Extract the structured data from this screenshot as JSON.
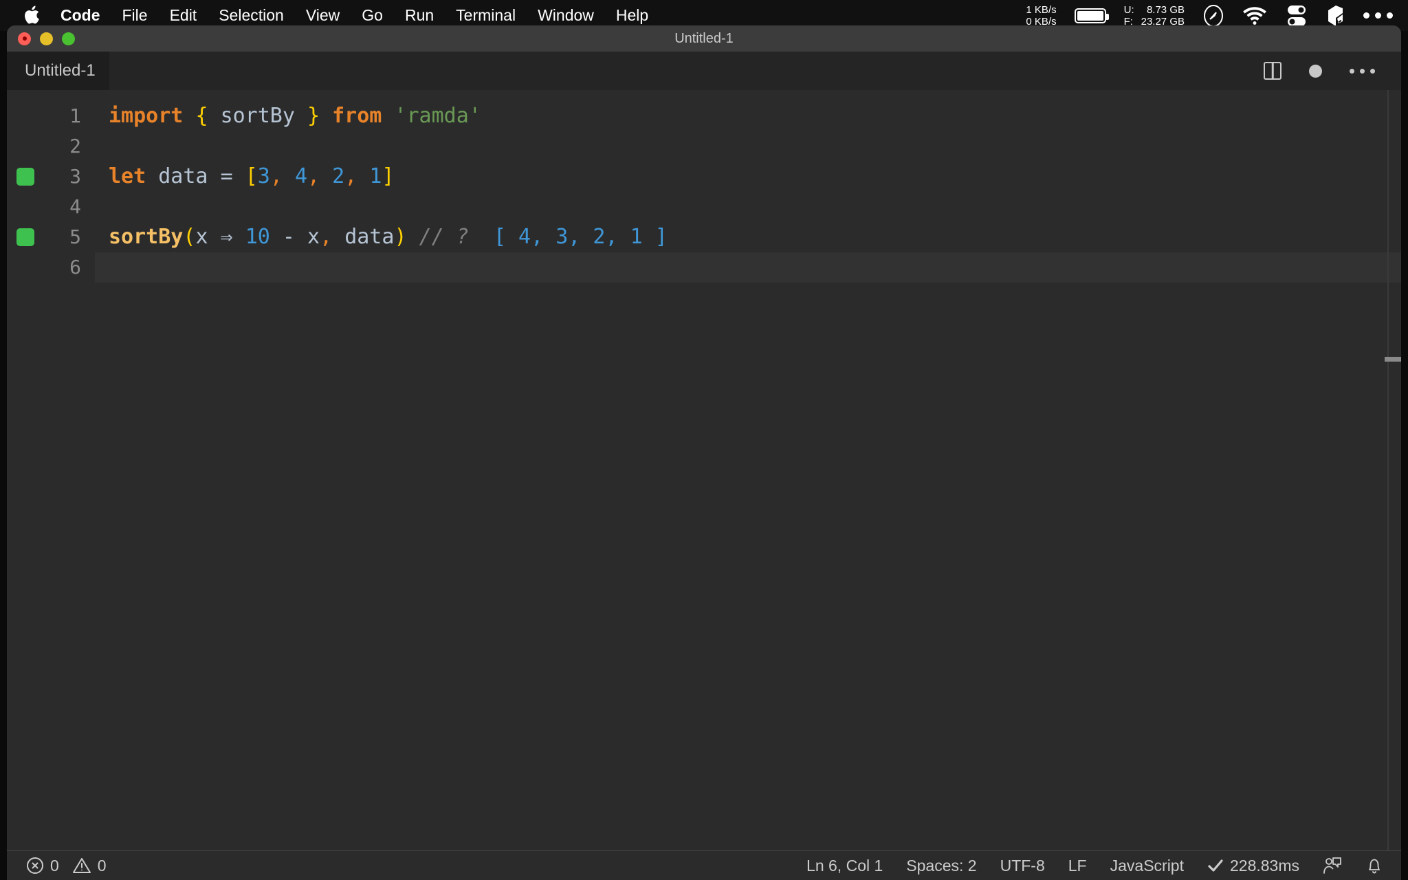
{
  "menubar": {
    "apple_icon": "apple-logo-icon",
    "items": [
      {
        "label": "Code",
        "bold": true
      },
      {
        "label": "File",
        "bold": false
      },
      {
        "label": "Edit",
        "bold": false
      },
      {
        "label": "Selection",
        "bold": false
      },
      {
        "label": "View",
        "bold": false
      },
      {
        "label": "Go",
        "bold": false
      },
      {
        "label": "Run",
        "bold": false
      },
      {
        "label": "Terminal",
        "bold": false
      },
      {
        "label": "Window",
        "bold": false
      },
      {
        "label": "Help",
        "bold": false
      }
    ],
    "network": {
      "upload": "1 KB/s",
      "download": "0 KB/s"
    },
    "battery_icon": "battery-icon",
    "memory": {
      "used_label": "U:",
      "used_value": "8.73 GB",
      "free_label": "F:",
      "free_value": "23.27 GB"
    },
    "status_icons": [
      "compass-gauge-icon",
      "wifi-icon",
      "toggles-icon",
      "dropbox-icon",
      "control-center-more-icon"
    ]
  },
  "window": {
    "title": "Untitled-1",
    "traffic_lights": [
      "close-button",
      "minimize-button",
      "maximize-button"
    ]
  },
  "tabs": {
    "active": "Untitled-1",
    "actions": [
      "split-editor-icon",
      "unsaved-dot-icon",
      "more-actions-icon"
    ]
  },
  "editor": {
    "language": "JavaScript",
    "lines": [
      {
        "number": "1",
        "marker": null,
        "active": false,
        "tokens": [
          {
            "text": "import",
            "cls": "t-kw"
          },
          {
            "text": " ",
            "cls": "t-plain"
          },
          {
            "text": "{",
            "cls": "t-brace"
          },
          {
            "text": " ",
            "cls": "t-plain"
          },
          {
            "text": "sortBy",
            "cls": "t-var"
          },
          {
            "text": " ",
            "cls": "t-plain"
          },
          {
            "text": "}",
            "cls": "t-brace"
          },
          {
            "text": " ",
            "cls": "t-plain"
          },
          {
            "text": "from",
            "cls": "t-kw"
          },
          {
            "text": " ",
            "cls": "t-plain"
          },
          {
            "text": "'ramda'",
            "cls": "t-str"
          }
        ]
      },
      {
        "number": "2",
        "marker": null,
        "active": false,
        "tokens": []
      },
      {
        "number": "3",
        "marker": "quokka-ok",
        "active": false,
        "tokens": [
          {
            "text": "let",
            "cls": "t-kw"
          },
          {
            "text": " ",
            "cls": "t-plain"
          },
          {
            "text": "data",
            "cls": "t-var"
          },
          {
            "text": " ",
            "cls": "t-plain"
          },
          {
            "text": "=",
            "cls": "t-op"
          },
          {
            "text": " ",
            "cls": "t-plain"
          },
          {
            "text": "[",
            "cls": "t-brace"
          },
          {
            "text": "3",
            "cls": "t-num"
          },
          {
            "text": ",",
            "cls": "t-comma"
          },
          {
            "text": " ",
            "cls": "t-plain"
          },
          {
            "text": "4",
            "cls": "t-num"
          },
          {
            "text": ",",
            "cls": "t-comma"
          },
          {
            "text": " ",
            "cls": "t-plain"
          },
          {
            "text": "2",
            "cls": "t-num"
          },
          {
            "text": ",",
            "cls": "t-comma"
          },
          {
            "text": " ",
            "cls": "t-plain"
          },
          {
            "text": "1",
            "cls": "t-num"
          },
          {
            "text": "]",
            "cls": "t-brace"
          }
        ]
      },
      {
        "number": "4",
        "marker": null,
        "active": false,
        "tokens": []
      },
      {
        "number": "5",
        "marker": "quokka-ok",
        "active": false,
        "tokens": [
          {
            "text": "sortBy",
            "cls": "t-fn"
          },
          {
            "text": "(",
            "cls": "t-paren"
          },
          {
            "text": "x",
            "cls": "t-var"
          },
          {
            "text": " ⇒ ",
            "cls": "t-op"
          },
          {
            "text": "10",
            "cls": "t-num"
          },
          {
            "text": " ",
            "cls": "t-plain"
          },
          {
            "text": "-",
            "cls": "t-op"
          },
          {
            "text": " ",
            "cls": "t-plain"
          },
          {
            "text": "x",
            "cls": "t-var"
          },
          {
            "text": ",",
            "cls": "t-comma"
          },
          {
            "text": " ",
            "cls": "t-plain"
          },
          {
            "text": "data",
            "cls": "t-var"
          },
          {
            "text": ")",
            "cls": "t-paren"
          },
          {
            "text": " ",
            "cls": "t-plain"
          },
          {
            "text": "// ?",
            "cls": "t-comment"
          },
          {
            "text": "  ",
            "cls": "t-plain"
          },
          {
            "text": "[ 4, 3, 2, 1 ]",
            "cls": "t-result"
          }
        ]
      },
      {
        "number": "6",
        "marker": null,
        "active": true,
        "tokens": []
      }
    ]
  },
  "statusbar": {
    "errors": {
      "icon": "error-circle-icon",
      "count": "0"
    },
    "warnings": {
      "icon": "warning-triangle-icon",
      "count": "0"
    },
    "cursor_position": "Ln 6, Col 1",
    "indentation": "Spaces: 2",
    "encoding": "UTF-8",
    "line_ending": "LF",
    "language_mode": "JavaScript",
    "run_status": {
      "icon": "check-icon",
      "label": "228.83ms"
    },
    "feedback_icon": "feedback-person-icon",
    "notifications_icon": "bell-icon"
  },
  "colors": {
    "menubar_bg": "#111111",
    "titlebar_bg": "#3c3c3c",
    "tabbar_bg": "#252526",
    "tab_active_bg": "#1e1e1e",
    "editor_bg": "#2b2b2b",
    "statusbar_bg": "#2b2b2b",
    "quokka_green": "#3ec14f",
    "keyword_orange": "#e8832a",
    "number_blue": "#3f97d8",
    "brace_yellow": "#ffd000",
    "string_green": "#6a9955",
    "function_yellow": "#f5c066"
  }
}
